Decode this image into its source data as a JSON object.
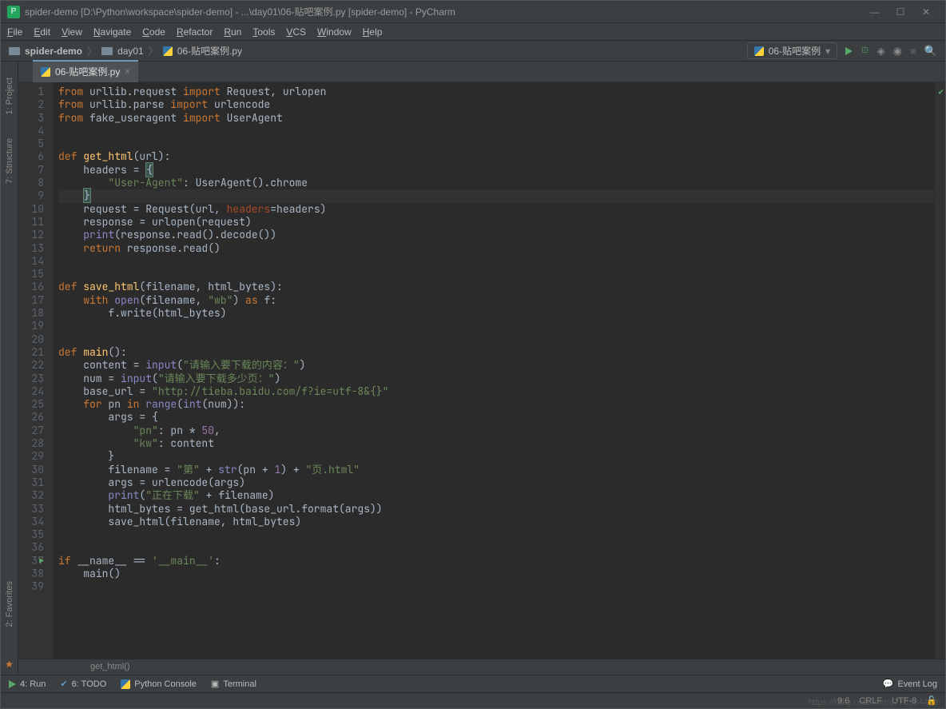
{
  "title": "spider-demo [D:\\Python\\workspace\\spider-demo] - ...\\day01\\06-贴吧案例.py [spider-demo] - PyCharm",
  "menu": [
    "File",
    "Edit",
    "View",
    "Navigate",
    "Code",
    "Refactor",
    "Run",
    "Tools",
    "VCS",
    "Window",
    "Help"
  ],
  "breadcrumb": {
    "root": "spider-demo",
    "folder": "day01",
    "file": "06-贴吧案例.py"
  },
  "run_config": "06-贴吧案例",
  "tab": {
    "name": "06-贴吧案例.py"
  },
  "left_tools": {
    "project": "1: Project",
    "structure": "7: Structure",
    "favorites": "2: Favorites"
  },
  "code_lines": [
    {
      "n": 1,
      "tokens": [
        [
          "kw",
          "from"
        ],
        [
          "op",
          " urllib.request "
        ],
        [
          "kw",
          "import"
        ],
        [
          "op",
          " Request, urlopen"
        ]
      ]
    },
    {
      "n": 2,
      "tokens": [
        [
          "kw",
          "from"
        ],
        [
          "op",
          " urllib.parse "
        ],
        [
          "kw",
          "import"
        ],
        [
          "op",
          " urlencode"
        ]
      ]
    },
    {
      "n": 3,
      "tokens": [
        [
          "kw",
          "from"
        ],
        [
          "op",
          " fake_useragent "
        ],
        [
          "kw",
          "import"
        ],
        [
          "op",
          " UserAgent"
        ]
      ]
    },
    {
      "n": 4,
      "tokens": []
    },
    {
      "n": 5,
      "tokens": []
    },
    {
      "n": 6,
      "tokens": [
        [
          "kw",
          "def "
        ],
        [
          "fn",
          "get_html"
        ],
        [
          "op",
          "(url):"
        ]
      ]
    },
    {
      "n": 7,
      "tokens": [
        [
          "op",
          "    headers = "
        ],
        [
          "brace",
          "{"
        ]
      ]
    },
    {
      "n": 8,
      "tokens": [
        [
          "op",
          "        "
        ],
        [
          "str",
          "\"User-Agent\""
        ],
        [
          "op",
          ": UserAgent().chrome"
        ]
      ]
    },
    {
      "n": 9,
      "hl": true,
      "tokens": [
        [
          "op",
          "    "
        ],
        [
          "brace",
          "}"
        ]
      ]
    },
    {
      "n": 10,
      "tokens": [
        [
          "op",
          "    request = Request(url, "
        ],
        [
          "param",
          "headers"
        ],
        [
          "op",
          "=headers)"
        ]
      ]
    },
    {
      "n": 11,
      "tokens": [
        [
          "op",
          "    response = urlopen(request)"
        ]
      ]
    },
    {
      "n": 12,
      "tokens": [
        [
          "op",
          "    "
        ],
        [
          "builtin",
          "print"
        ],
        [
          "op",
          "(response.read().decode())"
        ]
      ]
    },
    {
      "n": 13,
      "tokens": [
        [
          "op",
          "    "
        ],
        [
          "kw",
          "return"
        ],
        [
          "op",
          " response.read()"
        ]
      ]
    },
    {
      "n": 14,
      "tokens": []
    },
    {
      "n": 15,
      "tokens": []
    },
    {
      "n": 16,
      "tokens": [
        [
          "kw",
          "def "
        ],
        [
          "fn",
          "save_html"
        ],
        [
          "op",
          "(filename, html_bytes):"
        ]
      ]
    },
    {
      "n": 17,
      "tokens": [
        [
          "op",
          "    "
        ],
        [
          "kw",
          "with"
        ],
        [
          "op",
          " "
        ],
        [
          "builtin",
          "open"
        ],
        [
          "op",
          "(filename, "
        ],
        [
          "str",
          "\"wb\""
        ],
        [
          "op",
          ") "
        ],
        [
          "kw",
          "as"
        ],
        [
          "op",
          " f:"
        ]
      ]
    },
    {
      "n": 18,
      "tokens": [
        [
          "op",
          "        f.write(html_bytes)"
        ]
      ]
    },
    {
      "n": 19,
      "tokens": []
    },
    {
      "n": 20,
      "tokens": []
    },
    {
      "n": 21,
      "tokens": [
        [
          "kw",
          "def "
        ],
        [
          "fn",
          "main"
        ],
        [
          "op",
          "():"
        ]
      ]
    },
    {
      "n": 22,
      "tokens": [
        [
          "op",
          "    content = "
        ],
        [
          "builtin",
          "input"
        ],
        [
          "op",
          "("
        ],
        [
          "str",
          "\"请输入要下载的内容：\""
        ],
        [
          "op",
          ")"
        ]
      ]
    },
    {
      "n": 23,
      "tokens": [
        [
          "op",
          "    num = "
        ],
        [
          "builtin",
          "input"
        ],
        [
          "op",
          "("
        ],
        [
          "str",
          "\"请输入要下载多少页：\""
        ],
        [
          "op",
          ")"
        ]
      ]
    },
    {
      "n": 24,
      "tokens": [
        [
          "op",
          "    base_url = "
        ],
        [
          "str",
          "\"http://tieba.baidu.com/f?ie=utf-8&{}\""
        ]
      ]
    },
    {
      "n": 25,
      "tokens": [
        [
          "op",
          "    "
        ],
        [
          "kw",
          "for"
        ],
        [
          "op",
          " pn "
        ],
        [
          "kw",
          "in"
        ],
        [
          "op",
          " "
        ],
        [
          "builtin",
          "range"
        ],
        [
          "op",
          "("
        ],
        [
          "builtin",
          "int"
        ],
        [
          "op",
          "(num)):"
        ]
      ]
    },
    {
      "n": 26,
      "tokens": [
        [
          "op",
          "        args = {"
        ]
      ]
    },
    {
      "n": 27,
      "tokens": [
        [
          "op",
          "            "
        ],
        [
          "str",
          "\"pn\""
        ],
        [
          "op",
          ": pn * "
        ],
        [
          "pname",
          "50"
        ],
        [
          "op",
          ","
        ]
      ]
    },
    {
      "n": 28,
      "tokens": [
        [
          "op",
          "            "
        ],
        [
          "str",
          "\"kw\""
        ],
        [
          "op",
          ": content"
        ]
      ]
    },
    {
      "n": 29,
      "tokens": [
        [
          "op",
          "        }"
        ]
      ]
    },
    {
      "n": 30,
      "tokens": [
        [
          "op",
          "        filename = "
        ],
        [
          "str",
          "\"第\""
        ],
        [
          "op",
          " + "
        ],
        [
          "builtin",
          "str"
        ],
        [
          "op",
          "(pn + "
        ],
        [
          "pname",
          "1"
        ],
        [
          "op",
          ") + "
        ],
        [
          "str",
          "\"页.html\""
        ]
      ]
    },
    {
      "n": 31,
      "tokens": [
        [
          "op",
          "        args = urlencode(args)"
        ]
      ]
    },
    {
      "n": 32,
      "tokens": [
        [
          "op",
          "        "
        ],
        [
          "builtin",
          "print"
        ],
        [
          "op",
          "("
        ],
        [
          "str",
          "\"正在下载\""
        ],
        [
          "op",
          " + filename)"
        ]
      ]
    },
    {
      "n": 33,
      "tokens": [
        [
          "op",
          "        html_bytes = get_html(base_url.format(args))"
        ]
      ]
    },
    {
      "n": 34,
      "tokens": [
        [
          "op",
          "        save_html(filename, html_bytes)"
        ]
      ]
    },
    {
      "n": 35,
      "tokens": []
    },
    {
      "n": 36,
      "tokens": []
    },
    {
      "n": 37,
      "run": true,
      "tokens": [
        [
          "kw",
          "if"
        ],
        [
          "op",
          " __name__ == "
        ],
        [
          "str",
          "'__main__'"
        ],
        [
          "op",
          ":"
        ]
      ]
    },
    {
      "n": 38,
      "tokens": [
        [
          "op",
          "    main()"
        ]
      ]
    },
    {
      "n": 39,
      "tokens": []
    }
  ],
  "crumb": "get_html()",
  "bottom": {
    "run": "4: Run",
    "todo": "6: TODO",
    "console": "Python Console",
    "terminal": "Terminal",
    "eventlog": "Event Log"
  },
  "status": {
    "pos": "9:6",
    "sep": "CRLF",
    "enc": "UTF-8"
  },
  "watermark": "https://blog.csdn.net/a772304419"
}
